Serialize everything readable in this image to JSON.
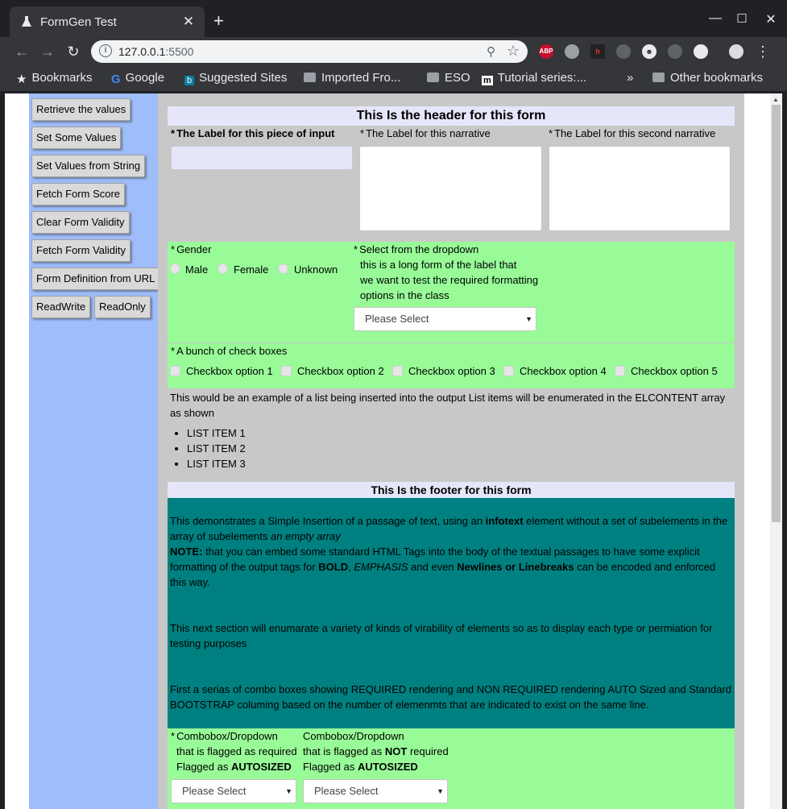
{
  "browser": {
    "tab_title": "FormGen Test",
    "tab_close": "✕",
    "new_tab": "+",
    "url_host": "127.0.0.1",
    "url_port": ":5500",
    "bookmarks": [
      {
        "label": "Bookmarks"
      },
      {
        "label": "Google"
      },
      {
        "label": "Suggested Sites"
      },
      {
        "label": "Imported Fro..."
      },
      {
        "label": "ESO"
      },
      {
        "label": "Tutorial series:..."
      }
    ],
    "overflow": "»",
    "other_bookmarks": "Other bookmarks",
    "extensions": [
      {
        "name": "adblock-plus-icon",
        "text": "ABP",
        "color": "#c70d2c"
      }
    ]
  },
  "sidebar": {
    "buttons": [
      "Retrieve the values",
      "Set Some Values",
      "Set Values from String",
      "Fetch Form Score",
      "Clear Form Validity",
      "Fetch Form Validity",
      "Form Definition from URL",
      "ReadWrite",
      "ReadOnly"
    ]
  },
  "form": {
    "header": "This Is the header for this form",
    "required_mark": "*",
    "input_label": "The Label for this piece of input",
    "narrative_label": "The Label for this narrative",
    "narrative2_label": "The Label for this second narrative",
    "gender": {
      "label": "Gender",
      "options": [
        "Male",
        "Female",
        "Unknown"
      ]
    },
    "dropdown": {
      "label_lines": [
        "Select from the dropdown",
        "this is a long form of the label that",
        "we want to test the required formatting",
        "options in the class"
      ],
      "value": "Please Select"
    },
    "checkboxes": {
      "label": "A bunch of check boxes",
      "options": [
        "Checkbox option 1",
        "Checkbox option 2",
        "Checkbox option 3",
        "Checkbox option 4",
        "Checkbox option 5"
      ]
    },
    "list_intro": "This would be an example of a list being inserted into the output List items will be enumerated in the ELCONTENT array as shown",
    "list_items": [
      "LIST ITEM 1",
      "LIST ITEM 2",
      "LIST ITEM 3"
    ],
    "footer": "This Is the footer for this form",
    "info": {
      "p1_a": "This demonstrates a Simple Insertion of a passage of text, using an ",
      "p1_b": "infotext",
      "p1_c": " element without a set of subelements in the array of subelements ",
      "p1_d": "an empty array",
      "note_label": "NOTE:",
      "note_a": " that you can embed some standard HTML Tags into the body of the textual passages to have some explicit formatting of the output tags for ",
      "note_b": "BOLD",
      "note_c": ", ",
      "note_d": "EMPHASIS",
      "note_e": " and even ",
      "note_f": "Newlines or Linebreaks",
      "note_g": " can be encoded and enforced this way.",
      "p2": "This next section will enumarate a variety of kinds of virability of elements so as to display each type or permiation for testing purposes",
      "p3": "First a serias of combo boxes showing REQUIRED rendering and NON REQUIRED rendering AUTO Sized and Standard BOOTSTRAP columing based on the number of elemenmts that are indicated to exist on the same line."
    },
    "combo1": {
      "line1": "Combobox/Dropdown",
      "line2": "that is flagged as required",
      "line3_a": "Flagged as ",
      "line3_b": "AUTOSIZED",
      "value": "Please Select"
    },
    "combo2": {
      "line1": "Combobox/Dropdown",
      "line2_a": "that is flagged as ",
      "line2_b": "NOT",
      "line2_c": " required",
      "line3_a": "Flagged as ",
      "line3_b": "AUTOSIZED",
      "value": "Please Select"
    }
  }
}
